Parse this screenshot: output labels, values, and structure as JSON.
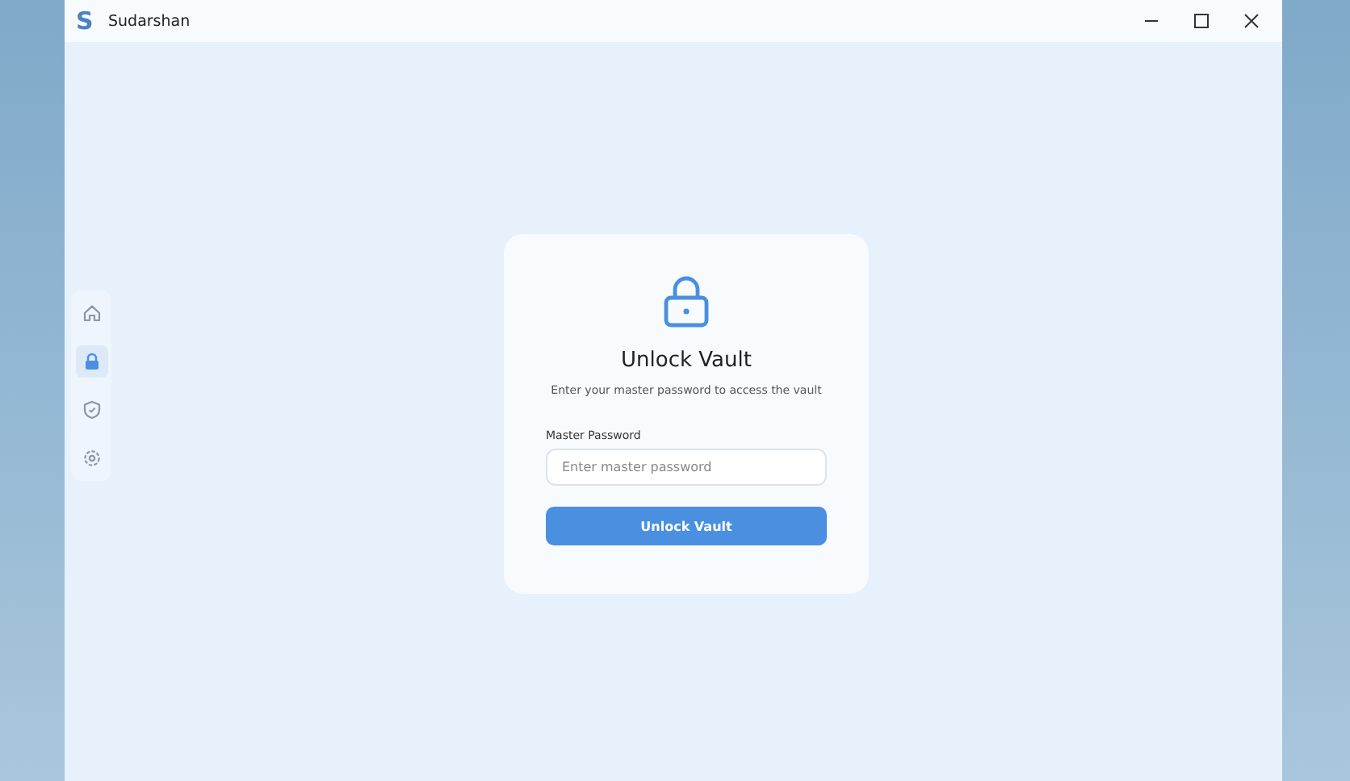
{
  "window": {
    "title": "Sudarshan",
    "logo": "S"
  },
  "sidebar": {
    "items": [
      {
        "kind": "home",
        "selected": false
      },
      {
        "kind": "lock",
        "selected": true
      },
      {
        "kind": "shield",
        "selected": false
      },
      {
        "kind": "settings",
        "selected": false
      }
    ]
  },
  "card": {
    "title": "Unlock Vault",
    "subtitle": "Enter your master password to access the vault",
    "field_label": "Master Password",
    "field": {
      "placeholder": "Enter master password"
    },
    "button": "Unlock Vault"
  }
}
